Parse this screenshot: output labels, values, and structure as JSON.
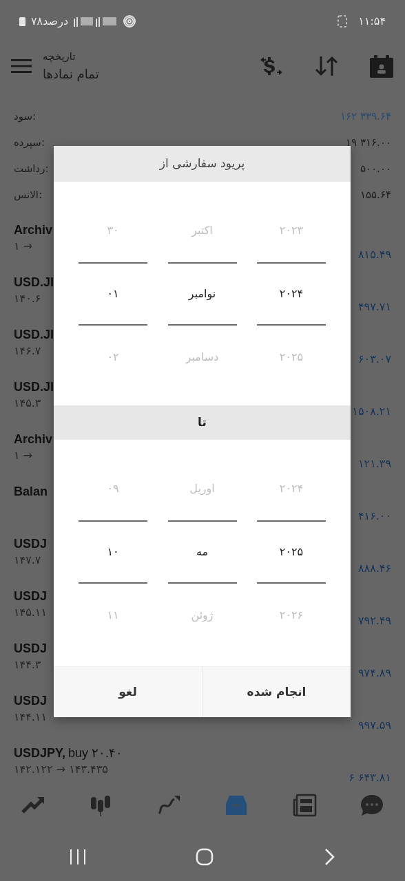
{
  "status_bar": {
    "battery": "۷۸درصد",
    "time": "۱۱:۵۴"
  },
  "header": {
    "subtitle": "تاریخچه",
    "title": "تمام نمادها"
  },
  "summary": [
    {
      "label": "سود:",
      "value": "۱۶۲ ۳۳۹.۶۴",
      "kind": "blue"
    },
    {
      "label": "سپرده:",
      "value": "۱۹ ۳۱۶.۰۰",
      "kind": "dark"
    },
    {
      "label": "رداشت:",
      "value": "۵۰۰.۰۰",
      "kind": "dark"
    },
    {
      "label": "الانس:",
      "value": "۱۵۵.۶۴",
      "kind": "dark"
    }
  ],
  "deals": [
    {
      "symbol": "Archiv",
      "detail": "۱ →",
      "amount": "۸۱۵.۴۹"
    },
    {
      "symbol": "USD.JI",
      "detail": "۱۴۰.۶",
      "amount": "۴۹۷.۷۱"
    },
    {
      "symbol": "USD.JI",
      "detail": "۱۴۶.۷",
      "amount": "۶۰۳.۰۷"
    },
    {
      "symbol": "USD.JI",
      "detail": "۱۴۵.۳",
      "amount": "۱۵۰۸.۲۱"
    },
    {
      "symbol": "Archiv",
      "detail": "۱ →",
      "amount": "۱۲۱.۳۹"
    },
    {
      "symbol": "Balan",
      "amount": "۴۱۶.۰۰"
    },
    {
      "symbol": "USDJ",
      "detail": "۱۴۷.۷",
      "amount": "۸۸۸.۴۶"
    },
    {
      "symbol": "USDJ",
      "detail": "۱۴۵.۱۱",
      "amount": "۷۹۲.۴۹"
    },
    {
      "symbol": "USDJ",
      "detail": "۱۴۴.۳",
      "amount": "۹۷۴.۸۹"
    },
    {
      "symbol": "USDJ",
      "detail": "۱۴۴.۱۱",
      "amount": "۹۹۷.۵۹"
    },
    {
      "symbol": "USDJPY,",
      "side": "buy ۲۰.۴۰",
      "detail": "۱۴۲.۱۲۲ → ۱۴۳.۴۳۵",
      "amount": "۶ ۶۴۳.۸۱"
    }
  ],
  "bottom_nav": [
    {
      "selected": false
    },
    {
      "selected": false
    },
    {
      "selected": false
    },
    {
      "selected": true
    },
    {
      "selected": false
    },
    {
      "selected": false
    }
  ],
  "dialog": {
    "title": "پریود سفارشی از",
    "from": [
      {
        "items": [
          {
            "text": "۲۰۲۳",
            "selected": false
          },
          {
            "text": "۲۰۲۴",
            "selected": true
          },
          {
            "text": "۲۰۲۵",
            "selected": false
          }
        ]
      },
      {
        "items": [
          {
            "text": "اکتبر",
            "selected": false
          },
          {
            "text": "نوامبر",
            "selected": true
          },
          {
            "text": "دسامبر",
            "selected": false
          }
        ]
      },
      {
        "items": [
          {
            "text": "۳۰",
            "selected": false
          },
          {
            "text": "۰۱",
            "selected": true
          },
          {
            "text": "۰۲",
            "selected": false
          }
        ]
      }
    ],
    "to_label": "تا",
    "to": [
      {
        "items": [
          {
            "text": "۲۰۲۴",
            "selected": false
          },
          {
            "text": "۲۰۲۵",
            "selected": true
          },
          {
            "text": "۲۰۲۶",
            "selected": false
          }
        ]
      },
      {
        "items": [
          {
            "text": "اوریل",
            "selected": false
          },
          {
            "text": "مه",
            "selected": true
          },
          {
            "text": "ژوئن",
            "selected": false
          }
        ]
      },
      {
        "items": [
          {
            "text": "۰۹",
            "selected": false
          },
          {
            "text": "۱۰",
            "selected": true
          },
          {
            "text": "۱۱",
            "selected": false
          }
        ]
      }
    ],
    "buttons": [
      {
        "label": "انجام شده"
      },
      {
        "label": "لغو"
      }
    ]
  }
}
